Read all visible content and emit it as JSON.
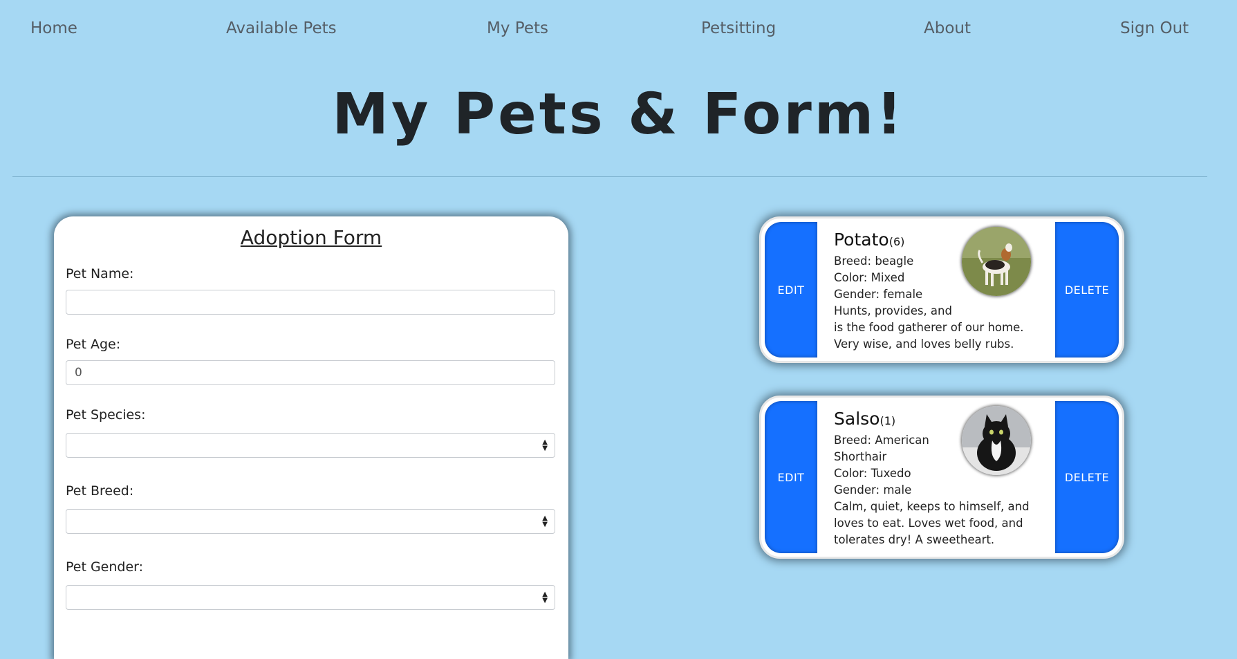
{
  "nav": {
    "home": "Home",
    "available_pets": "Available Pets",
    "my_pets": "My Pets",
    "petsitting": "Petsitting",
    "about": "About",
    "sign_out": "Sign Out"
  },
  "page_title": "My Pets & Form!",
  "form": {
    "heading": "Adoption Form",
    "pet_name_label": "Pet Name:",
    "pet_name_value": "",
    "pet_age_label": "Pet Age:",
    "pet_age_value": "0",
    "pet_species_label": "Pet Species:",
    "pet_species_value": "",
    "pet_breed_label": "Pet Breed:",
    "pet_breed_value": "",
    "pet_gender_label": "Pet Gender:",
    "pet_gender_value": ""
  },
  "pets": [
    {
      "name": "Potato",
      "age": "(6)",
      "breed": "Breed: beagle",
      "color": "Color: Mixed",
      "gender": "Gender: female",
      "desc_lines": [
        "Hunts, provides, and",
        "is the food gatherer of our home.",
        "Very wise, and loves belly rubs."
      ],
      "edit_label": "EDIT",
      "delete_label": "DELETE",
      "photo_icon": "beagle-dog-photo"
    },
    {
      "name": "Salso",
      "age": "(1)",
      "breed_lines": [
        "Breed: American",
        "Shorthair"
      ],
      "color": "Color: Tuxedo",
      "gender": "Gender: male",
      "desc_lines": [
        "Calm, quiet, keeps to himself, and",
        "loves to eat. Loves wet food, and",
        "tolerates dry! A sweetheart."
      ],
      "edit_label": "EDIT",
      "delete_label": "DELETE",
      "photo_icon": "tuxedo-cat-photo"
    }
  ],
  "colors": {
    "background": "#a6d8f3",
    "button_blue": "#1570ff"
  }
}
